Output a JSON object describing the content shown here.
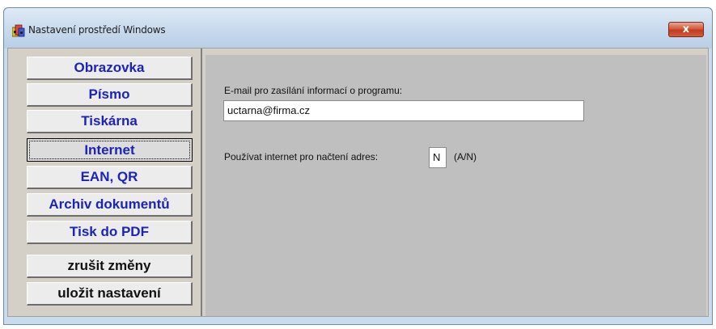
{
  "window": {
    "title": "Nastavení prostředí Windows",
    "close_glyph": "x",
    "app_icon": "settings-app-icon"
  },
  "sidebar": {
    "items": [
      {
        "label": "Obrazovka",
        "active": false
      },
      {
        "label": "Písmo",
        "active": false
      },
      {
        "label": "Tiskárna",
        "active": false
      },
      {
        "label": "Internet",
        "active": true
      },
      {
        "label": "EAN, QR",
        "active": false
      },
      {
        "label": "Archiv dokumentů",
        "active": false
      },
      {
        "label": "Tisk do PDF",
        "active": false
      }
    ],
    "actions": [
      {
        "label": "zrušit změny"
      },
      {
        "label": "uložit nastavení"
      }
    ]
  },
  "internet": {
    "email_label": "E-mail pro zasílání informací o programu:",
    "email_value": "uctarna@firma.cz",
    "use_internet_label": "Používat internet pro načtení adres:",
    "use_internet_value": "N",
    "use_internet_hint": "(A/N)"
  },
  "colors": {
    "nav_text": "#1b23b8",
    "panel_bg": "#bfbfbf",
    "dialog_bg": "#d4d0c8"
  }
}
